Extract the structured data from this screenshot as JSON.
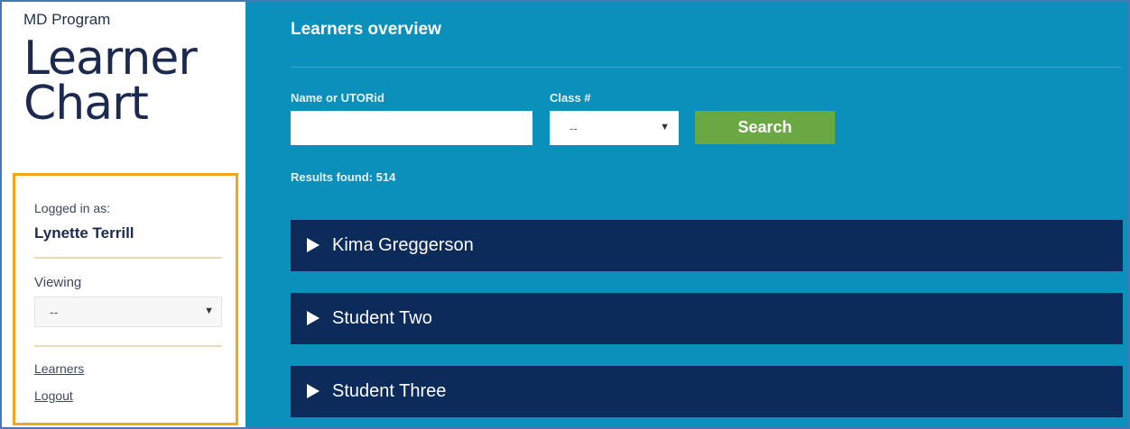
{
  "sidebar": {
    "program": "MD Program",
    "title_line1": "Learner",
    "title_line2": "Chart",
    "logged_in_label": "Logged in as:",
    "user_name": "Lynette Terrill",
    "viewing_label": "Viewing",
    "viewing_value": "--",
    "links": [
      "Learners",
      "Logout"
    ]
  },
  "main": {
    "title": "Learners overview",
    "name_label": "Name or UTORid",
    "name_value": "",
    "class_label": "Class #",
    "class_value": "--",
    "search_label": "Search",
    "results": "Results found: 514",
    "learners": [
      "Kima Greggerson",
      "Student Two",
      "Student Three"
    ]
  },
  "colors": {
    "main_bg": "#0b8fbb",
    "row_bg": "#0c2b5a",
    "search_button": "#6aa843",
    "panel_border": "#f2a71b",
    "title_text": "#1b2a4e"
  },
  "icons": {
    "dropdown": "caret-down-icon",
    "expand": "triangle-right-icon"
  }
}
